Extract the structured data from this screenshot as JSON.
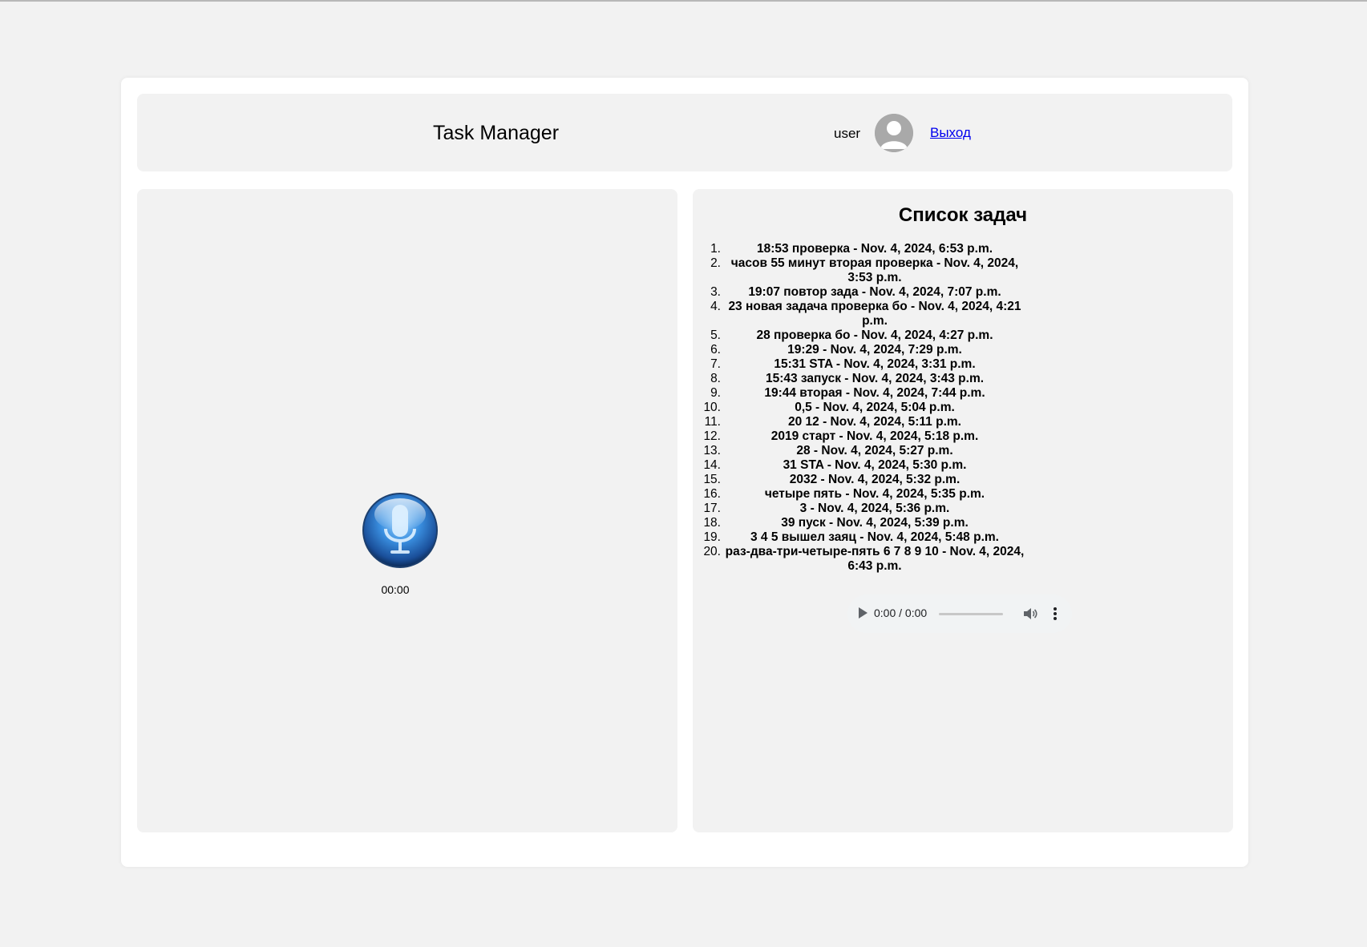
{
  "header": {
    "title": "Task Manager",
    "username": "user",
    "logout_label": "Выход"
  },
  "recorder": {
    "timer": "00:00"
  },
  "tasks": {
    "title": "Список задач",
    "items": [
      {
        "num": "1.",
        "text": "18:53 проверка - Nov. 4, 2024, 6:53 p.m."
      },
      {
        "num": "2.",
        "text": "часов 55 минут вторая проверка - Nov. 4, 2024, 3:53 p.m."
      },
      {
        "num": "3.",
        "text": "19:07 повтор зада - Nov. 4, 2024, 7:07 p.m."
      },
      {
        "num": "4.",
        "text": "23 новая задача проверка бо - Nov. 4, 2024, 4:21 p.m."
      },
      {
        "num": "5.",
        "text": "28 проверка бо - Nov. 4, 2024, 4:27 p.m."
      },
      {
        "num": "6.",
        "text": "19:29 - Nov. 4, 2024, 7:29 p.m."
      },
      {
        "num": "7.",
        "text": "15:31 STA - Nov. 4, 2024, 3:31 p.m."
      },
      {
        "num": "8.",
        "text": "15:43 запуск - Nov. 4, 2024, 3:43 p.m."
      },
      {
        "num": "9.",
        "text": "19:44 вторая - Nov. 4, 2024, 7:44 p.m."
      },
      {
        "num": "10.",
        "text": "0,5 - Nov. 4, 2024, 5:04 p.m."
      },
      {
        "num": "11.",
        "text": "20 12 - Nov. 4, 2024, 5:11 p.m."
      },
      {
        "num": "12.",
        "text": "2019 старт - Nov. 4, 2024, 5:18 p.m."
      },
      {
        "num": "13.",
        "text": "28 - Nov. 4, 2024, 5:27 p.m."
      },
      {
        "num": "14.",
        "text": "31 STA - Nov. 4, 2024, 5:30 p.m."
      },
      {
        "num": "15.",
        "text": "2032 - Nov. 4, 2024, 5:32 p.m."
      },
      {
        "num": "16.",
        "text": "четыре пять - Nov. 4, 2024, 5:35 p.m."
      },
      {
        "num": "17.",
        "text": "3 - Nov. 4, 2024, 5:36 p.m."
      },
      {
        "num": "18.",
        "text": "39 пуск - Nov. 4, 2024, 5:39 p.m."
      },
      {
        "num": "19.",
        "text": "3 4 5 вышел заяц - Nov. 4, 2024, 5:48 p.m."
      },
      {
        "num": "20.",
        "text": "раз-два-три-четыре-пять 6 7 8 9 10 - Nov. 4, 2024, 6:43 p.m."
      }
    ]
  },
  "audio_player": {
    "time": "0:00 / 0:00"
  }
}
